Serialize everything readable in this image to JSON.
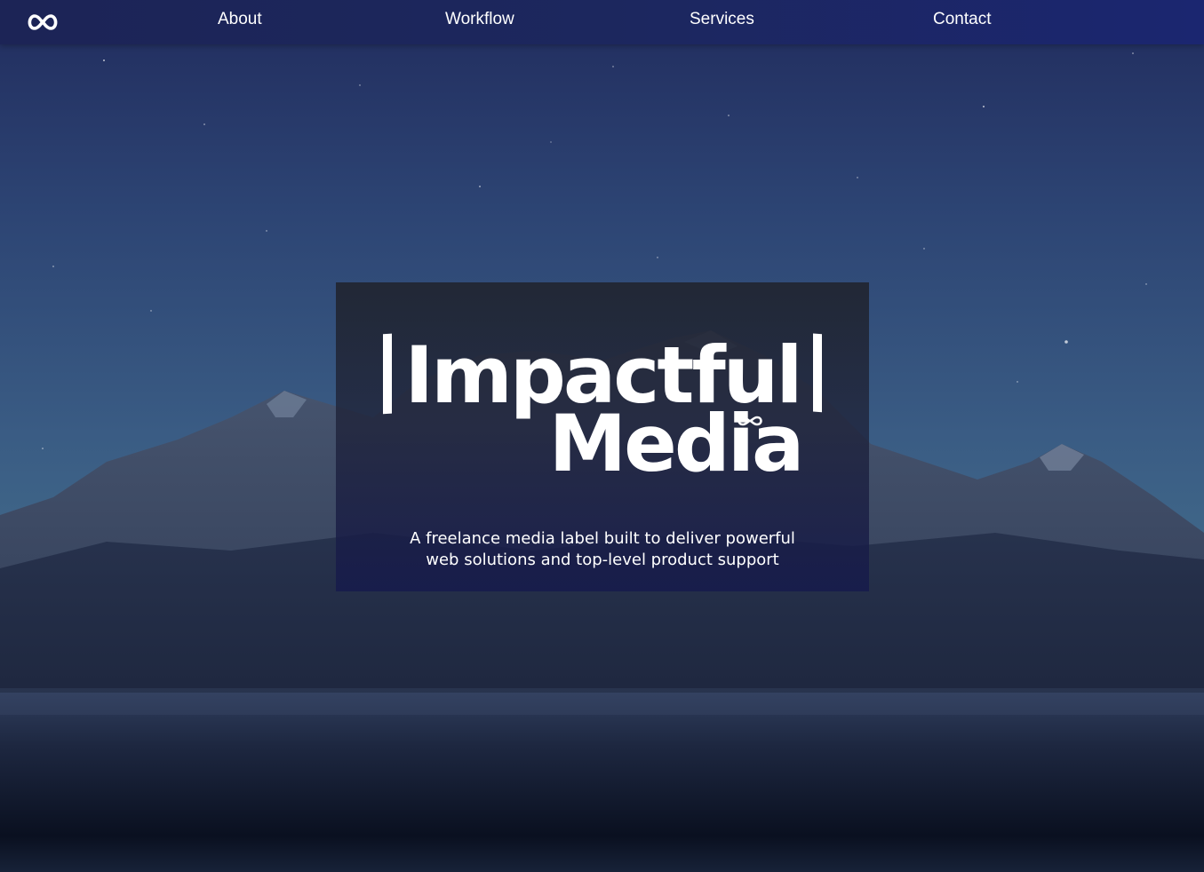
{
  "nav": {
    "logo_icon": "infinity-icon",
    "links": [
      {
        "label": "About"
      },
      {
        "label": "Workflow"
      },
      {
        "label": "Services"
      },
      {
        "label": "Contact"
      }
    ]
  },
  "hero": {
    "title_line1": "Impactful",
    "title_line2": "Media",
    "tagline_line1": "A freelance media label built to deliver powerful",
    "tagline_line2": "web solutions and top-level product support",
    "background": "starry-mountain-night-photo"
  },
  "colors": {
    "nav_bg": "#1c2456",
    "text": "#ffffff",
    "card_bg": "#212530"
  }
}
